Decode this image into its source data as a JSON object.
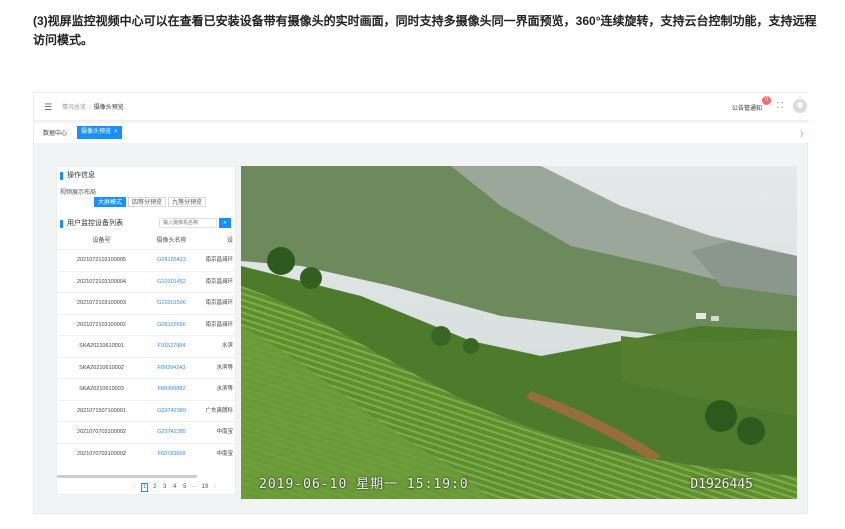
{
  "intro": "(3)视屏监控视频中心可以在查看已安装设备带有摄像头的实时画面，同时支持多摄像头同一界面预览，360°连续旋转，支持云台控制功能，支持远程访问模式。",
  "header": {
    "menu_icon": "hamburger-icon",
    "breadcrumb": {
      "home": "情况总览",
      "separator": "/",
      "current": "摄像头预览"
    },
    "notice_label": "公告管通知",
    "notice_badge": "0",
    "fullscreen_icon": "fullscreen-icon",
    "avatar_icon": "user-avatar-icon"
  },
  "tabs": {
    "home": "数据中心",
    "active": "摄像头预览",
    "close": "×",
    "collapse": "〉"
  },
  "panel": {
    "section_ops": "操作信息",
    "layout_label": "视频展示布局",
    "layout_options": [
      "大屏模式",
      "四等分预览",
      "九等分预览"
    ],
    "active_layout": "大屏模式",
    "section_devices": "用户监控设备列表",
    "search_placeholder": "输入摄像机名称",
    "search_icon": "search-icon",
    "columns": [
      "设备号",
      "摄像头名称",
      "设"
    ],
    "rows": [
      [
        "2021072103100005",
        "G08165423",
        "南京昌澜环"
      ],
      [
        "2021072103100004",
        "G10301452",
        "南京昌澜环"
      ],
      [
        "2021072103100003",
        "G10301506",
        "南京昌澜环"
      ],
      [
        "2021072103100002",
        "G08165556",
        "南京昌澜环"
      ],
      [
        "SKA20210610001",
        "F91527984",
        "水滨"
      ],
      [
        "SKA20210610002",
        "F89304243",
        "水滨等"
      ],
      [
        "SKA20210610003",
        "F89309882",
        "水滨等"
      ],
      [
        "2021071507100001",
        "G29742389",
        "广东爽朗科"
      ],
      [
        "2021070703100002",
        "G29742385",
        "中南宝"
      ],
      [
        "2021070703100002",
        "F60783668",
        "中南宝"
      ]
    ],
    "pagination": {
      "prev": "‹",
      "pages": [
        "1",
        "2",
        "3",
        "4",
        "5",
        "···",
        "19"
      ],
      "active": "1",
      "next": "›"
    }
  },
  "video": {
    "timestamp": "2019-06-10  星期一  15:19:0",
    "camera_id": "D1926445"
  }
}
